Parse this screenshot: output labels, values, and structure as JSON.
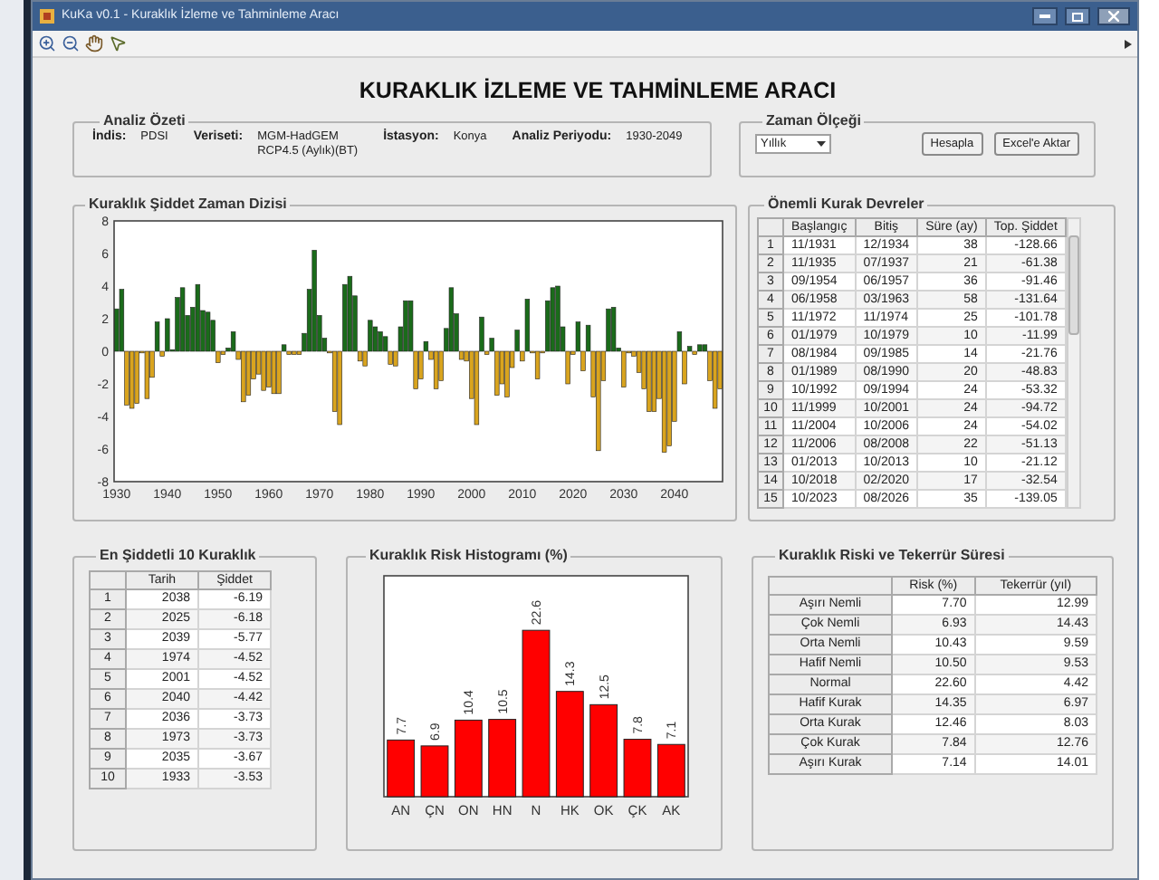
{
  "window": {
    "title": "KuKa v0.1 - Kuraklık İzleme ve Tahminleme Aracı"
  },
  "heading": "KURAKLIK İZLEME VE TAHMİNLEME ARACI",
  "summary": {
    "title": "Analiz Özeti",
    "fields": [
      {
        "label": "İndis:",
        "lines": [
          "PDSI"
        ]
      },
      {
        "label": "Veriseti:",
        "lines": [
          "MGM-HadGEM",
          "RCP4.5 (Aylık)(BT)"
        ]
      },
      {
        "label": "İstasyon:",
        "lines": [
          "Konya"
        ]
      },
      {
        "label": "Analiz Periyodu:",
        "lines": [
          "1930-2049"
        ]
      }
    ]
  },
  "time_scale": {
    "title": "Zaman Ölçeği",
    "select": {
      "value": "Yıllık"
    },
    "buttons": [
      "Hesapla",
      "Excel'e Aktar"
    ]
  },
  "time_series": {
    "title": "Kuraklık Şiddet Zaman Dizisi",
    "chart_data": {
      "type": "bar",
      "xlim": [
        1929.5,
        2049.5
      ],
      "ylim": [
        -8,
        8
      ],
      "xticks": [
        1930,
        1940,
        1950,
        1960,
        1970,
        1980,
        1990,
        2000,
        2010,
        2020,
        2030,
        2040
      ],
      "yticks": [
        -8,
        -6,
        -4,
        -2,
        0,
        2,
        4,
        6,
        8
      ],
      "x": [
        1930,
        1931,
        1932,
        1933,
        1934,
        1935,
        1936,
        1937,
        1938,
        1939,
        1940,
        1941,
        1942,
        1943,
        1944,
        1945,
        1946,
        1947,
        1948,
        1949,
        1950,
        1951,
        1952,
        1953,
        1954,
        1955,
        1956,
        1957,
        1958,
        1959,
        1960,
        1961,
        1962,
        1963,
        1964,
        1965,
        1966,
        1967,
        1968,
        1969,
        1970,
        1971,
        1972,
        1973,
        1974,
        1975,
        1976,
        1977,
        1978,
        1979,
        1980,
        1981,
        1982,
        1983,
        1984,
        1985,
        1986,
        1987,
        1988,
        1989,
        1990,
        1991,
        1992,
        1993,
        1994,
        1995,
        1996,
        1997,
        1998,
        1999,
        2000,
        2001,
        2002,
        2003,
        2004,
        2005,
        2006,
        2007,
        2008,
        2009,
        2010,
        2011,
        2012,
        2013,
        2014,
        2015,
        2016,
        2017,
        2018,
        2019,
        2020,
        2021,
        2022,
        2023,
        2024,
        2025,
        2026,
        2027,
        2028,
        2029,
        2030,
        2031,
        2032,
        2033,
        2034,
        2035,
        2036,
        2037,
        2038,
        2039,
        2040,
        2041,
        2042,
        2043,
        2044,
        2045,
        2046,
        2047,
        2048,
        2049
      ],
      "series": [
        {
          "color": "#1a6b1a",
          "values": [
            2.6,
            3.8,
            null,
            null,
            null,
            null,
            null,
            null,
            1.8,
            null,
            2.0,
            0.1,
            3.3,
            3.9,
            2.2,
            2.7,
            4.1,
            2.5,
            2.4,
            1.9,
            null,
            null,
            0.2,
            1.2,
            null,
            null,
            null,
            null,
            null,
            null,
            null,
            null,
            null,
            0.4,
            null,
            null,
            null,
            1.1,
            3.8,
            6.2,
            2.2,
            0.8,
            null,
            null,
            null,
            4.1,
            4.6,
            3.4,
            null,
            null,
            1.9,
            1.5,
            1.2,
            0.9,
            null,
            null,
            1.5,
            3.1,
            3.1,
            null,
            null,
            0.6,
            null,
            null,
            null,
            1.4,
            3.9,
            2.3,
            null,
            null,
            null,
            null,
            2.1,
            null,
            0.8,
            null,
            null,
            null,
            null,
            1.3,
            null,
            3.2,
            null,
            null,
            null,
            3.1,
            3.9,
            4.0,
            1.5,
            null,
            null,
            1.8,
            null,
            1.6,
            null,
            null,
            null,
            2.6,
            2.7,
            0.2,
            null,
            null,
            null,
            null,
            null,
            null,
            null,
            null,
            null,
            null,
            null,
            1.2,
            null,
            0.3,
            null,
            0.4,
            0.4,
            null,
            null,
            null
          ]
        },
        {
          "color": "#d9a41e",
          "values": [
            null,
            null,
            -3.3,
            -3.5,
            -3.2,
            -0.1,
            -2.9,
            -1.6,
            null,
            -0.3,
            null,
            null,
            null,
            null,
            null,
            null,
            null,
            null,
            null,
            null,
            -0.7,
            -0.2,
            null,
            null,
            -0.5,
            -3.1,
            -2.7,
            -1.7,
            -1.4,
            -2.4,
            -2.2,
            -2.6,
            -2.6,
            null,
            -0.2,
            -0.2,
            -0.2,
            null,
            null,
            null,
            null,
            null,
            -0.1,
            -3.7,
            -4.5,
            null,
            null,
            null,
            -0.6,
            -0.9,
            null,
            null,
            null,
            null,
            -0.8,
            -0.9,
            null,
            null,
            null,
            -2.3,
            -1.7,
            null,
            -0.5,
            -2.3,
            -1.8,
            null,
            null,
            null,
            -0.5,
            -0.6,
            -2.9,
            -4.5,
            null,
            -0.2,
            null,
            -2.7,
            -2.0,
            -2.8,
            -1.0,
            null,
            -0.6,
            null,
            -0.1,
            -1.7,
            -0.1,
            null,
            null,
            null,
            null,
            -2.0,
            -0.2,
            null,
            -1.2,
            null,
            -2.8,
            -6.1,
            -1.8,
            null,
            null,
            null,
            -2.2,
            -0.1,
            -0.3,
            -1.3,
            -2.3,
            -3.7,
            -3.7,
            -2.9,
            -6.2,
            -5.8,
            -4.3,
            null,
            -2.0,
            null,
            -0.2,
            null,
            null,
            -1.8,
            -3.5,
            -2.3
          ]
        }
      ]
    }
  },
  "periods": {
    "title": "Önemli Kurak Devreler",
    "columns": [
      "Başlangıç",
      "Bitiş",
      "Süre (ay)",
      "Top. Şiddet"
    ],
    "rows": [
      {
        "number": "1",
        "cells": [
          "11/1931",
          "12/1934",
          "38",
          "-128.66"
        ]
      },
      {
        "number": "2",
        "cells": [
          "11/1935",
          "07/1937",
          "21",
          "-61.38"
        ]
      },
      {
        "number": "3",
        "cells": [
          "09/1954",
          "06/1957",
          "36",
          "-91.46"
        ]
      },
      {
        "number": "4",
        "cells": [
          "06/1958",
          "03/1963",
          "58",
          "-131.64"
        ]
      },
      {
        "number": "5",
        "cells": [
          "11/1972",
          "11/1974",
          "25",
          "-101.78"
        ]
      },
      {
        "number": "6",
        "cells": [
          "01/1979",
          "10/1979",
          "10",
          "-11.99"
        ]
      },
      {
        "number": "7",
        "cells": [
          "08/1984",
          "09/1985",
          "14",
          "-21.76"
        ]
      },
      {
        "number": "8",
        "cells": [
          "01/1989",
          "08/1990",
          "20",
          "-48.83"
        ]
      },
      {
        "number": "9",
        "cells": [
          "10/1992",
          "09/1994",
          "24",
          "-53.32"
        ]
      },
      {
        "number": "10",
        "cells": [
          "11/1999",
          "10/2001",
          "24",
          "-94.72"
        ]
      },
      {
        "number": "11",
        "cells": [
          "11/2004",
          "10/2006",
          "24",
          "-54.02"
        ]
      },
      {
        "number": "12",
        "cells": [
          "11/2006",
          "08/2008",
          "22",
          "-51.13"
        ]
      },
      {
        "number": "13",
        "cells": [
          "01/2013",
          "10/2013",
          "10",
          "-21.12"
        ]
      },
      {
        "number": "14",
        "cells": [
          "10/2018",
          "02/2020",
          "17",
          "-32.54"
        ]
      },
      {
        "number": "15",
        "cells": [
          "10/2023",
          "08/2026",
          "35",
          "-139.05"
        ]
      }
    ]
  },
  "top10": {
    "title": "En Şiddetli 10 Kuraklık",
    "columns": [
      "Tarih",
      "Şiddet"
    ],
    "rows": [
      {
        "number": "1",
        "cells": [
          "2038",
          "-6.19"
        ]
      },
      {
        "number": "2",
        "cells": [
          "2025",
          "-6.18"
        ]
      },
      {
        "number": "3",
        "cells": [
          "2039",
          "-5.77"
        ]
      },
      {
        "number": "4",
        "cells": [
          "1974",
          "-4.52"
        ]
      },
      {
        "number": "5",
        "cells": [
          "2001",
          "-4.52"
        ]
      },
      {
        "number": "6",
        "cells": [
          "2040",
          "-4.42"
        ]
      },
      {
        "number": "7",
        "cells": [
          "2036",
          "-3.73"
        ]
      },
      {
        "number": "8",
        "cells": [
          "1973",
          "-3.73"
        ]
      },
      {
        "number": "9",
        "cells": [
          "2035",
          "-3.67"
        ]
      },
      {
        "number": "10",
        "cells": [
          "1933",
          "-3.53"
        ]
      }
    ]
  },
  "histogram": {
    "title": "Kuraklık Risk Histogramı (%)",
    "chart_data": {
      "type": "bar",
      "categories": [
        "AN",
        "ÇN",
        "ON",
        "HN",
        "N",
        "HK",
        "OK",
        "ÇK",
        "AK"
      ],
      "ylim": [
        0,
        30
      ],
      "data_labels": true,
      "series": [
        {
          "color": "#ff0000",
          "values": [
            7.7,
            6.9,
            10.4,
            10.5,
            22.6,
            14.3,
            12.5,
            7.8,
            7.1
          ]
        }
      ]
    }
  },
  "risk": {
    "title": "Kuraklık Riski ve Tekerrür Süresi",
    "columns": [
      "Risk (%)",
      "Tekerrür (yıl)"
    ],
    "rows": [
      {
        "label": "Aşırı Nemli",
        "cells": [
          "7.70",
          "12.99"
        ]
      },
      {
        "label": "Çok Nemli",
        "cells": [
          "6.93",
          "14.43"
        ]
      },
      {
        "label": "Orta Nemli",
        "cells": [
          "10.43",
          "9.59"
        ]
      },
      {
        "label": "Hafif Nemli",
        "cells": [
          "10.50",
          "9.53"
        ]
      },
      {
        "label": "Normal",
        "cells": [
          "22.60",
          "4.42"
        ]
      },
      {
        "label": "Hafif Kurak",
        "cells": [
          "14.35",
          "6.97"
        ]
      },
      {
        "label": "Orta Kurak",
        "cells": [
          "12.46",
          "8.03"
        ]
      },
      {
        "label": "Çok Kurak",
        "cells": [
          "7.84",
          "12.76"
        ]
      },
      {
        "label": "Aşırı Kurak",
        "cells": [
          "7.14",
          "14.01"
        ]
      }
    ]
  }
}
